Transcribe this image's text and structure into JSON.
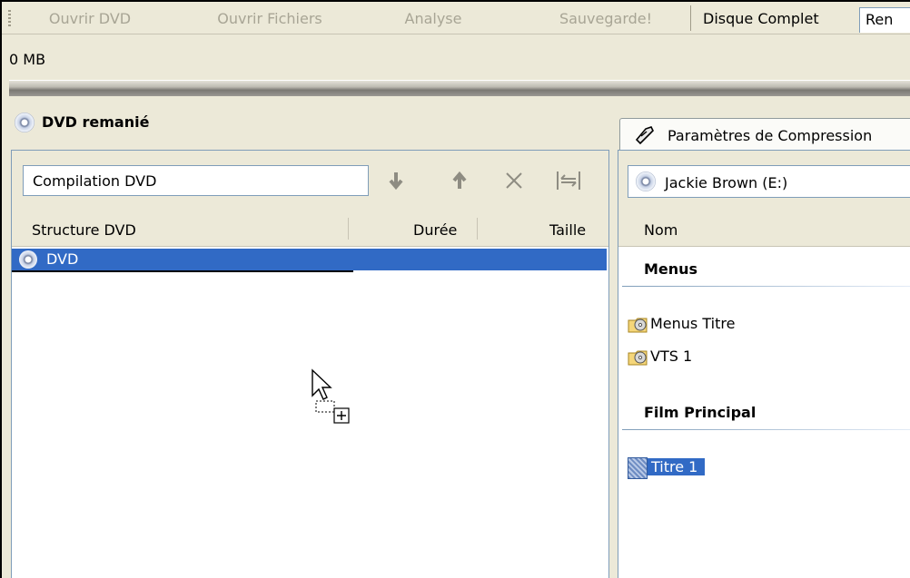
{
  "toolbar": {
    "buttons": [
      "Ouvrir DVD",
      "Ouvrir Fichiers",
      "Analyse",
      "Sauvegarde!"
    ],
    "tabs": [
      "Disque Complet",
      "Ren"
    ]
  },
  "size": {
    "text": "0 MB"
  },
  "left": {
    "title": "DVD remanié",
    "name_input": "Compilation DVD",
    "columns": [
      "Structure DVD",
      "Durée",
      "Taille"
    ],
    "rows": [
      {
        "label": "DVD",
        "selected": true
      }
    ],
    "icons": [
      "arrow-down-icon",
      "arrow-up-icon",
      "delete-icon",
      "fit-icon"
    ]
  },
  "right": {
    "tab_label": "Paramètres de Compression",
    "drive_label": "Jackie Brown (E:)",
    "column": "Nom",
    "groups": {
      "menus": "Menus",
      "film": "Film Principal"
    },
    "items": {
      "menus_titre": "Menus Titre",
      "vts1": "VTS 1",
      "titre1": "Titre 1"
    }
  },
  "colors": {
    "selection": "#316ac5",
    "border": "#7f9db9",
    "background": "#ece9d8"
  }
}
